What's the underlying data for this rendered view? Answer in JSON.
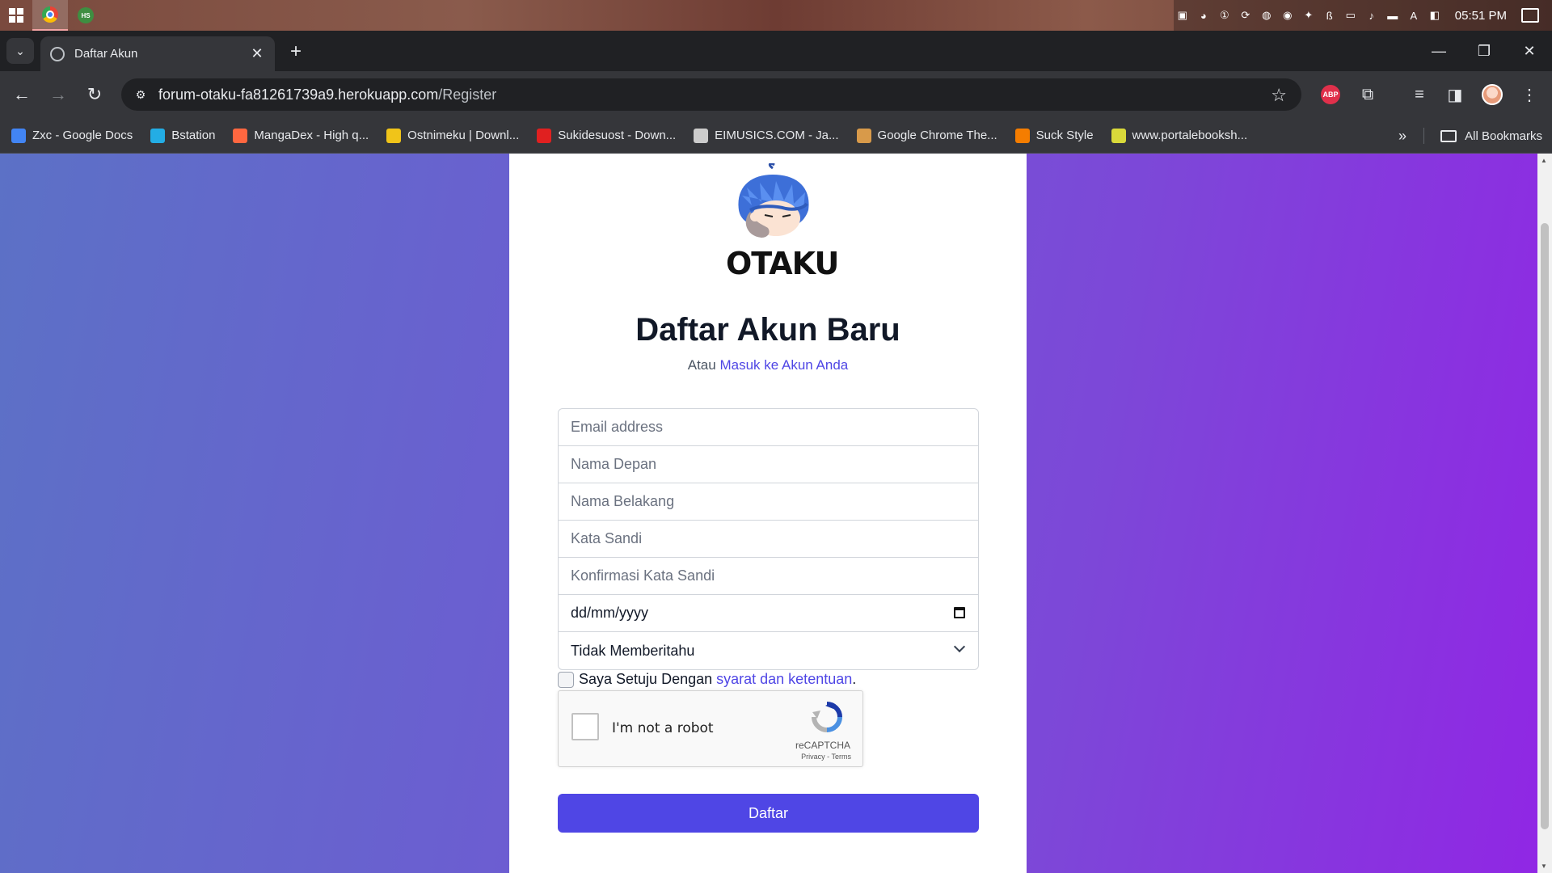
{
  "taskbar": {
    "time": "05:51 PM"
  },
  "browser": {
    "tab_title": "Daftar Akun",
    "url_host": "forum-otaku-fa81261739a9.herokuapp.com",
    "url_path": "/Register",
    "bookmarks": [
      {
        "label": "Zxc - Google Docs",
        "color": "#4285f4"
      },
      {
        "label": "Bstation",
        "color": "#23ade5"
      },
      {
        "label": "MangaDex - High q...",
        "color": "#ff6740"
      },
      {
        "label": "Ostnimeku | Downl...",
        "color": "#f0c419"
      },
      {
        "label": "Sukidesuost - Down...",
        "color": "#e02020"
      },
      {
        "label": "EIMUSICS.COM - Ja...",
        "color": "#cccccc"
      },
      {
        "label": "Google Chrome The...",
        "color": "#d89a4a"
      },
      {
        "label": "Suck Style",
        "color": "#f57d00"
      },
      {
        "label": "www.portalebooksh...",
        "color": "#d9d93a"
      }
    ],
    "all_bookmarks": "All Bookmarks"
  },
  "page": {
    "logo_text": "OTAKU",
    "title": "Daftar Akun Baru",
    "subtitle_prefix": "Atau",
    "login_link": "Masuk ke Akun Anda",
    "fields": {
      "email_placeholder": "Email address",
      "first_name_placeholder": "Nama Depan",
      "last_name_placeholder": "Nama Belakang",
      "password_placeholder": "Kata Sandi",
      "confirm_password_placeholder": "Konfirmasi Kata Sandi",
      "date_value": "dd/mm/yyyy",
      "gender_value": "Tidak Memberitahu"
    },
    "terms_prefix": "Saya Setuju Dengan",
    "terms_link": "syarat dan ketentuan",
    "terms_suffix": ".",
    "recaptcha": {
      "label": "I'm not a robot",
      "brand": "reCAPTCHA",
      "links": "Privacy - Terms"
    },
    "submit_label": "Daftar"
  },
  "colors": {
    "accent": "#4f46e5",
    "bg_start": "#5c71c6",
    "bg_end": "#9027e4"
  }
}
